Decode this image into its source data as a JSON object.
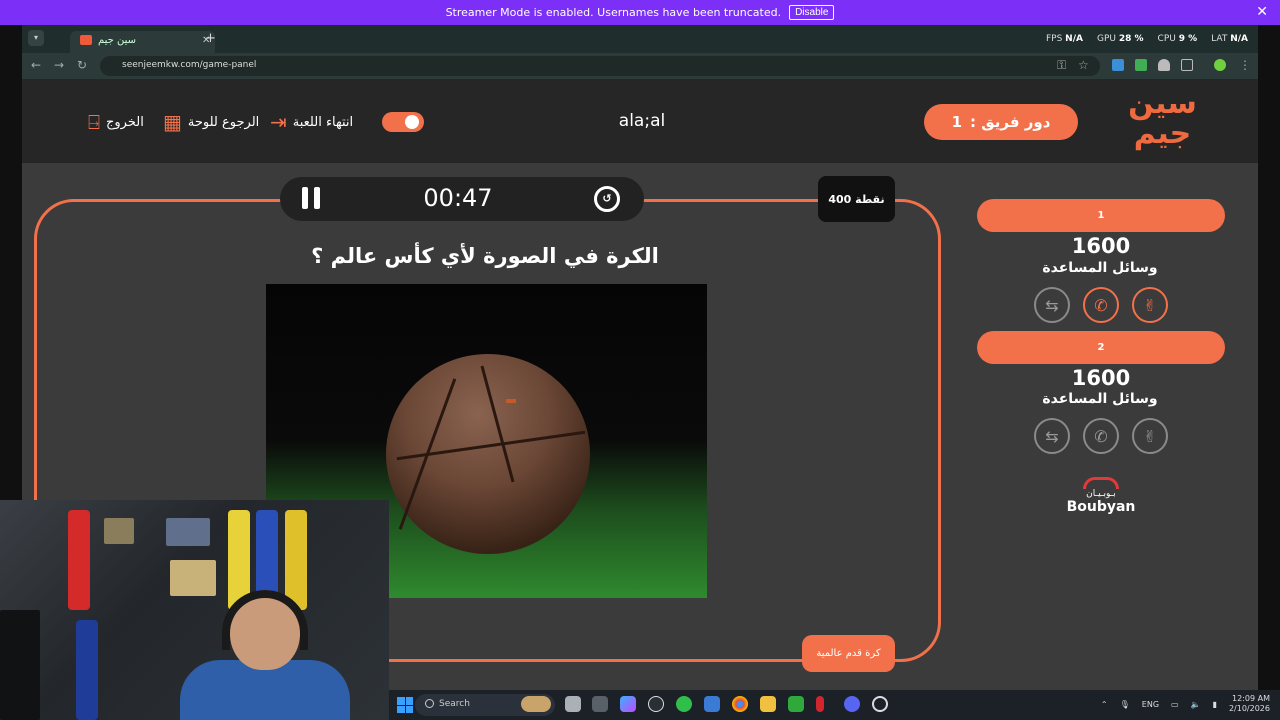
{
  "streamer": {
    "message": "Streamer Mode is enabled. Usernames have been truncated.",
    "disable_label": "Disable",
    "close_glyph": "✕"
  },
  "browser": {
    "tab_title": "سين جيم",
    "url": "seenjeemkw.com/game-panel",
    "perf": {
      "fps_label": "FPS",
      "fps": "N/A",
      "gpu_label": "GPU",
      "gpu": "28 %",
      "cpu_label": "CPU",
      "cpu": "9 %",
      "lat_label": "LAT",
      "lat": "N/A"
    }
  },
  "header": {
    "logo_line1": "سين",
    "logo_line2": "جيم",
    "team_turn_label": "دور فريق :",
    "team_turn_value": "1",
    "player_name": "ala;al",
    "end_game": "انتهاء اللعبة",
    "back_to_board": "الرجوع للوحة",
    "exit": "الخروج"
  },
  "question": {
    "timer": "00:47",
    "points": "400 نقطة",
    "text": "الكرة في الصورة لأي كأس عالم ؟",
    "category": "كرة قدم عالمية"
  },
  "teams": [
    {
      "name": "1",
      "score": "1600",
      "help_label": "وسائل المساعدة"
    },
    {
      "name": "2",
      "score": "1600",
      "help_label": "وسائل المساعدة"
    }
  ],
  "sponsor": {
    "arabic": "بـوبـيـان",
    "english": "Boubyan",
    "color": "#e23a3a"
  },
  "taskbar": {
    "search_placeholder": "Search",
    "lang": "ENG",
    "time": "12:09 AM",
    "date": "2/10/2026"
  },
  "colors": {
    "accent": "#f2714a",
    "streamer_bar": "#7b2ff7",
    "panel_bg": "#3b3b3b"
  }
}
